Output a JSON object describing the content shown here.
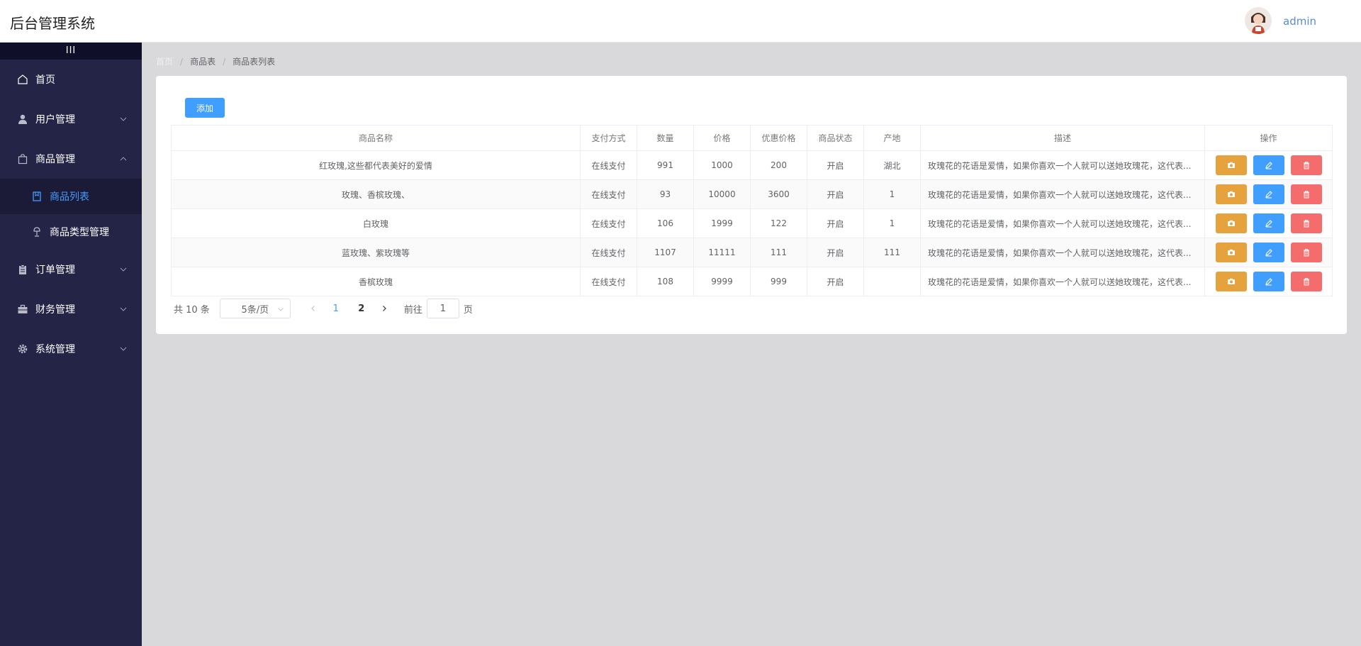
{
  "app": {
    "title": "后台管理系统"
  },
  "user": {
    "name": "admin"
  },
  "sidebar": {
    "collapse_glyph": "III",
    "items": [
      {
        "label": "首页",
        "icon": "home-icon"
      },
      {
        "label": "用户管理",
        "icon": "user-icon"
      },
      {
        "label": "商品管理",
        "icon": "shopping-bag-icon",
        "expanded": true
      },
      {
        "label": "订单管理",
        "icon": "clipboard-icon"
      },
      {
        "label": "财务管理",
        "icon": "briefcase-icon"
      },
      {
        "label": "系统管理",
        "icon": "gear-icon"
      }
    ],
    "subitems": [
      {
        "label": "商品列表",
        "icon": "notebook-icon",
        "active": true
      },
      {
        "label": "商品类型管理",
        "icon": "lamp-icon"
      }
    ]
  },
  "breadcrumb": [
    "首页",
    "商品表",
    "商品表列表"
  ],
  "toolbar": {
    "add_label": "添加"
  },
  "table": {
    "headers": [
      "商品名称",
      "支付方式",
      "数量",
      "价格",
      "优惠价格",
      "商品状态",
      "产地",
      "描述",
      "操作"
    ],
    "rows": [
      {
        "name": "红玫瑰,这些都代表美好的爱情",
        "pay": "在线支付",
        "qty": "991",
        "price": "1000",
        "discount": "200",
        "status": "开启",
        "origin": "湖北",
        "desc": "玫瑰花的花语是爱情，如果你喜欢一个人就可以送她玫瑰花，这代表..."
      },
      {
        "name": "玫瑰、香槟玫瑰、",
        "pay": "在线支付",
        "qty": "93",
        "price": "10000",
        "discount": "3600",
        "status": "开启",
        "origin": "1",
        "desc": "玫瑰花的花语是爱情，如果你喜欢一个人就可以送她玫瑰花，这代表..."
      },
      {
        "name": "白玫瑰",
        "pay": "在线支付",
        "qty": "106",
        "price": "1999",
        "discount": "122",
        "status": "开启",
        "origin": "1",
        "desc": "玫瑰花的花语是爱情，如果你喜欢一个人就可以送她玫瑰花，这代表..."
      },
      {
        "name": "蓝玫瑰、紫玫瑰等",
        "pay": "在线支付",
        "qty": "1107",
        "price": "11111",
        "discount": "111",
        "status": "开启",
        "origin": "111",
        "desc": "玫瑰花的花语是爱情，如果你喜欢一个人就可以送她玫瑰花，这代表..."
      },
      {
        "name": "香槟玫瑰",
        "pay": "在线支付",
        "qty": "108",
        "price": "9999",
        "discount": "999",
        "status": "开启",
        "origin": "",
        "desc": "玫瑰花的花语是爱情，如果你喜欢一个人就可以送她玫瑰花，这代表..."
      }
    ],
    "row_actions": [
      "camera-icon",
      "edit-icon",
      "delete-icon"
    ]
  },
  "pagination": {
    "total_text": "共 10 条",
    "page_size": "5条/页",
    "pages": [
      "1",
      "2"
    ],
    "current_page": "1",
    "goto_prefix": "前往",
    "goto_value": "1",
    "goto_suffix": "页"
  },
  "colors": {
    "sidebar_bg": "#242447",
    "accent": "#409eff",
    "warning": "#e6a23c",
    "danger": "#f56c6c",
    "content_bg": "#d9d9dc"
  }
}
